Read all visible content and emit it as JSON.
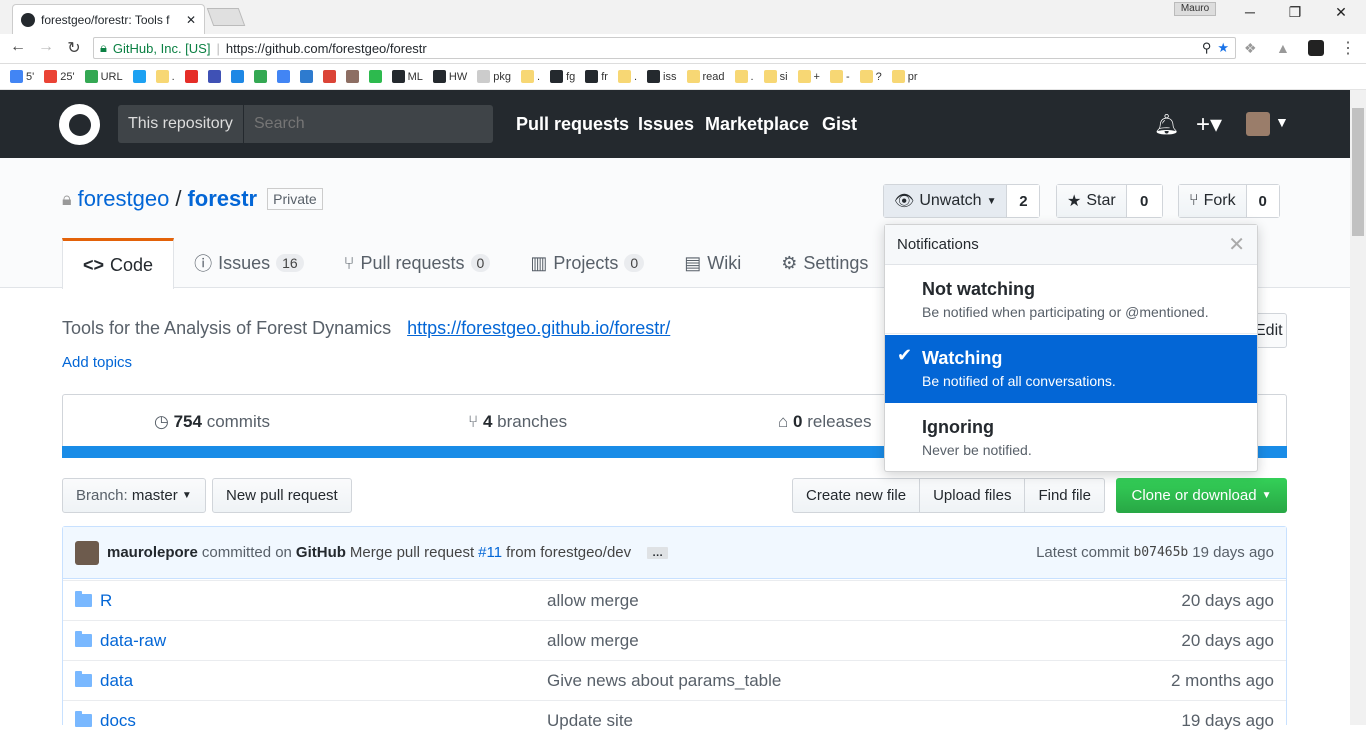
{
  "browser": {
    "tab_title": "forestgeo/forestr: Tools f",
    "user": "Mauro",
    "secure_label": "GitHub, Inc. [US]",
    "url": "https://github.com/forestgeo/forestr",
    "bookmarks": [
      {
        "label": "5'",
        "icon": "google-icon",
        "color": "#4285f4"
      },
      {
        "label": "25'",
        "icon": "google-icon",
        "color": "#ea4335"
      },
      {
        "label": "URL",
        "icon": "google-icon",
        "color": "#34a853"
      },
      {
        "label": "",
        "icon": "twitter-icon",
        "color": "#1da1f2"
      },
      {
        "label": ".",
        "icon": "folder-icon",
        "color": "#f7d774"
      },
      {
        "label": "",
        "icon": "youtube-icon",
        "color": "#e52d27"
      },
      {
        "label": "",
        "icon": "contacts-icon",
        "color": "#3f51b5"
      },
      {
        "label": "",
        "icon": "calendar-icon",
        "color": "#1e88e5"
      },
      {
        "label": "",
        "icon": "maps-icon",
        "color": "#34a853"
      },
      {
        "label": "",
        "icon": "docs-icon",
        "color": "#4285f4"
      },
      {
        "label": "",
        "icon": "sites-icon",
        "color": "#2e7bcf"
      },
      {
        "label": "",
        "icon": "gmail-icon",
        "color": "#db4437"
      },
      {
        "label": "",
        "icon": "box-icon",
        "color": "#8d6e63"
      },
      {
        "label": "",
        "icon": "github-green-icon",
        "color": "#2dba4e"
      },
      {
        "label": "ML",
        "icon": "github-icon",
        "color": "#24292e"
      },
      {
        "label": "HW",
        "icon": "github-icon",
        "color": "#24292e"
      },
      {
        "label": "pkg",
        "icon": "page-icon",
        "color": "#cccccc"
      },
      {
        "label": ".",
        "icon": "folder-icon",
        "color": "#f7d774"
      },
      {
        "label": "fg",
        "icon": "github-icon",
        "color": "#24292e"
      },
      {
        "label": "fr",
        "icon": "github-icon",
        "color": "#24292e"
      },
      {
        "label": ".",
        "icon": "folder-icon",
        "color": "#f7d774"
      },
      {
        "label": "iss",
        "icon": "github-icon",
        "color": "#24292e"
      },
      {
        "label": "read",
        "icon": "folder-icon",
        "color": "#f7d774"
      },
      {
        "label": ".",
        "icon": "folder-icon",
        "color": "#f7d774"
      },
      {
        "label": "si",
        "icon": "folder-icon",
        "color": "#f7d774"
      },
      {
        "label": "+",
        "icon": "folder-icon",
        "color": "#f7d774"
      },
      {
        "label": "-",
        "icon": "folder-icon",
        "color": "#f7d774"
      },
      {
        "label": "?",
        "icon": "folder-icon",
        "color": "#f7d774"
      },
      {
        "label": "pr",
        "icon": "folder-icon",
        "color": "#f7d774"
      }
    ]
  },
  "header": {
    "scope": "This repository",
    "search_placeholder": "Search",
    "nav": [
      "Pull requests",
      "Issues",
      "Marketplace",
      "Gist"
    ]
  },
  "repo": {
    "owner": "forestgeo",
    "slash": "/",
    "name": "forestr",
    "visibility": "Private",
    "unwatch_label": "Unwatch",
    "watch_count": "2",
    "star_label": "Star",
    "star_count": "0",
    "fork_label": "Fork",
    "fork_count": "0",
    "tabs": [
      {
        "label": "Code",
        "icon": "code-icon",
        "count": ""
      },
      {
        "label": "Issues",
        "icon": "issue-icon",
        "count": "16"
      },
      {
        "label": "Pull requests",
        "icon": "pull-request-icon",
        "count": "0"
      },
      {
        "label": "Projects",
        "icon": "project-icon",
        "count": "0"
      },
      {
        "label": "Wiki",
        "icon": "book-icon",
        "count": ""
      },
      {
        "label": "Settings",
        "icon": "gear-icon",
        "count": ""
      }
    ],
    "description": "Tools for the Analysis of Forest Dynamics",
    "website": "https://forestgeo.github.io/forestr/",
    "add_topics": "Add topics",
    "edit_label": "Edit",
    "commits_n": "754",
    "commits_label": "commits",
    "branches_n": "4",
    "branches_label": "branches",
    "releases_n": "0",
    "releases_label": "releases",
    "language_color": "#198ce7"
  },
  "filebar": {
    "branch_label": "Branch:",
    "branch_value": "master",
    "new_pr": "New pull request",
    "create_file": "Create new file",
    "upload_files": "Upload files",
    "find_file": "Find file",
    "clone": "Clone or download"
  },
  "commit": {
    "author": "maurolepore",
    "via": "committed on",
    "platform": "GitHub",
    "message_pre": "Merge pull request",
    "pr": "#11",
    "message_post": "from forestgeo/dev",
    "ellipsis": "…",
    "latest_label": "Latest commit",
    "sha": "b07465b",
    "age": "19 days ago"
  },
  "files": [
    {
      "name": "R",
      "message": "allow merge",
      "age": "20 days ago"
    },
    {
      "name": "data-raw",
      "message": "allow merge",
      "age": "20 days ago"
    },
    {
      "name": "data",
      "message": "Give news about params_table",
      "age": "2 months ago"
    },
    {
      "name": "docs",
      "message": "Update site",
      "age": "19 days ago"
    }
  ],
  "notifications": {
    "title": "Notifications",
    "options": [
      {
        "title": "Not watching",
        "desc": "Be notified when participating or @mentioned.",
        "selected": false
      },
      {
        "title": "Watching",
        "desc": "Be notified of all conversations.",
        "selected": true
      },
      {
        "title": "Ignoring",
        "desc": "Never be notified.",
        "selected": false
      }
    ]
  }
}
